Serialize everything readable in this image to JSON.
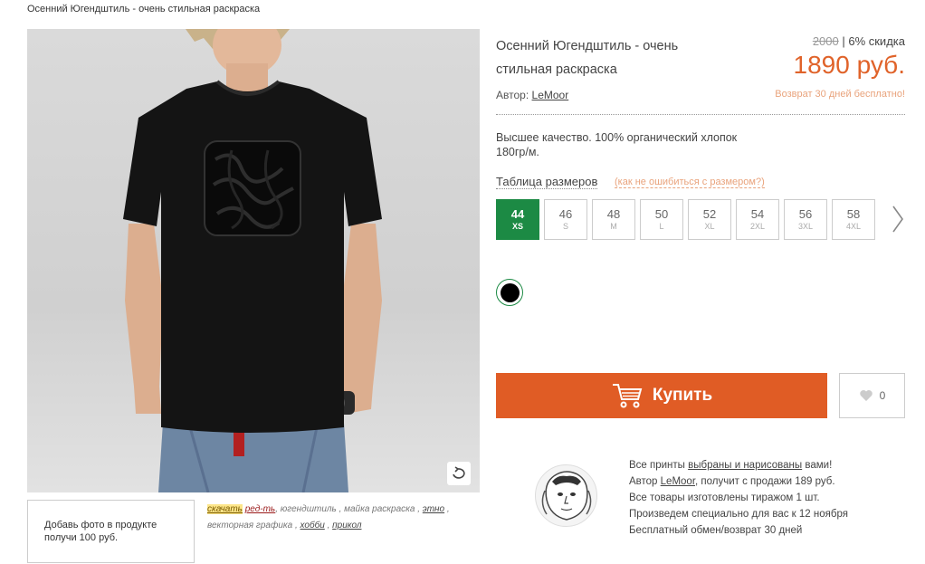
{
  "breadcrumb": "Осенний Югендштиль - очень стильная раскраска",
  "product": {
    "title": "Осенний Югендштиль - очень стильная раскраска",
    "author_label": "Автор:",
    "author_name": "LeMoor",
    "old_price": "2000",
    "discount": "| 6% скидка",
    "price": "1890 руб.",
    "return_note": "Возврат 30 дней бесплатно!",
    "description": "Высшее качество. 100% органический хлопок 180гр/м."
  },
  "sizes": {
    "table_label": "Таблица размеров",
    "help_label": "(как не ошибиться с размером?)",
    "selected": "44",
    "items": [
      {
        "num": "44",
        "letter": "XS"
      },
      {
        "num": "46",
        "letter": "S"
      },
      {
        "num": "48",
        "letter": "M"
      },
      {
        "num": "50",
        "letter": "L"
      },
      {
        "num": "52",
        "letter": "XL"
      },
      {
        "num": "54",
        "letter": "2XL"
      },
      {
        "num": "56",
        "letter": "3XL"
      },
      {
        "num": "58",
        "letter": "4XL"
      }
    ]
  },
  "colors": {
    "selected": "#000000"
  },
  "actions": {
    "buy_label": "Купить",
    "like_count": "0"
  },
  "gallery": {
    "add_photo_text": "Добавь фото в продукте получи 100 руб."
  },
  "tags": [
    {
      "text": "скачать",
      "style": "hl-y"
    },
    {
      "text": "ред-ть",
      "style": "hl-r"
    },
    {
      "text": "югендштиль",
      "link": false
    },
    {
      "text": "майка раскраска",
      "link": false
    },
    {
      "text": "этно",
      "link": true
    },
    {
      "text": "векторная графика",
      "link": false
    },
    {
      "text": "хобби",
      "link": true
    },
    {
      "text": "прикол",
      "link": true
    }
  ],
  "info": {
    "line1_pre": "Все принты ",
    "line1_link": "выбраны и нарисованы",
    "line1_post": " вами!",
    "line2_pre": "Автор ",
    "line2_link": "LeMoor",
    "line2_post": ", получит с продажи 189 руб.",
    "line3": "Все товары изготовлены тиражом 1 шт.",
    "line4": "Произведем специально для вас к 12 ноября",
    "line5": "Бесплатный обмен/возврат 30 дней"
  },
  "colors_theme": {
    "accent": "#e05c25",
    "green": "#1c8a44",
    "peach": "#e9a37c"
  },
  "icons": [
    "rotate-icon",
    "cart-icon",
    "heart-icon",
    "chevron-right-icon",
    "lion-portrait-logo"
  ]
}
